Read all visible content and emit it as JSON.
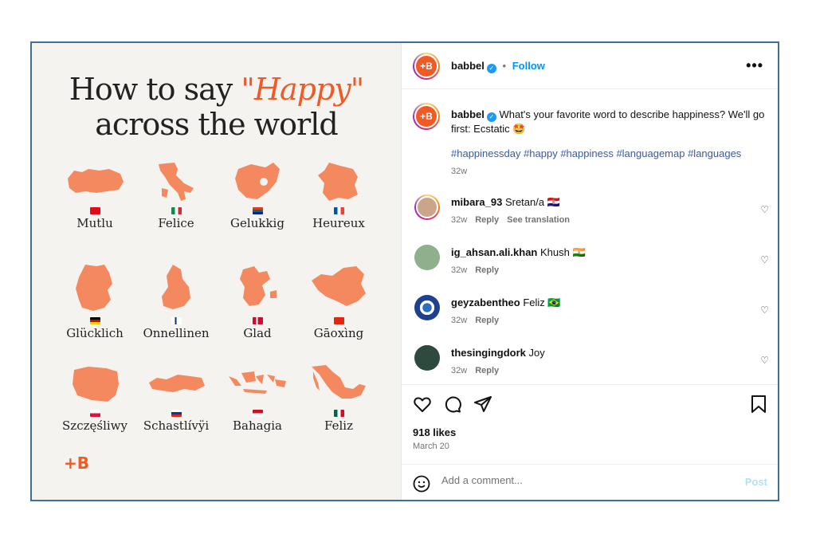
{
  "post_image": {
    "title_line1_prefix": "How to say ",
    "title_accent": "\"Happy\"",
    "title_line2": "across the world",
    "logo": "+B",
    "accent_color": "#f15a24",
    "items": [
      {
        "word": "Mutlu",
        "country": "Turkey"
      },
      {
        "word": "Felice",
        "country": "Italy"
      },
      {
        "word": "Gelukkig",
        "country": "South Africa"
      },
      {
        "word": "Heureux",
        "country": "France"
      },
      {
        "word": "Glücklich",
        "country": "Germany"
      },
      {
        "word": "Onnellinen",
        "country": "Finland"
      },
      {
        "word": "Glad",
        "country": "Denmark"
      },
      {
        "word": "Gāoxìng",
        "country": "China"
      },
      {
        "word": "Szczęśliwy",
        "country": "Poland"
      },
      {
        "word": "Schastlívÿi",
        "country": "Russia"
      },
      {
        "word": "Bahagia",
        "country": "Indonesia"
      },
      {
        "word": "Feliz",
        "country": "Mexico"
      }
    ]
  },
  "header": {
    "avatar_text": "+B",
    "username": "babbel",
    "separator": "•",
    "follow_label": "Follow",
    "more_icon": "more-horizontal-icon"
  },
  "caption": {
    "username": "babbel",
    "text": "What's your favorite word to describe happiness? We'll go first: Ecstatic 🤩",
    "hashtags": "#happinessday #happy #happiness #languagemap #languages",
    "time": "32w"
  },
  "comments": [
    {
      "username": "mibara_93",
      "text": "Sretan/a 🇭🇷",
      "time": "32w",
      "reply": "Reply",
      "translate": "See translation"
    },
    {
      "username": "ig_ahsan.ali.khan",
      "text": "Khush 🇮🇳",
      "time": "32w",
      "reply": "Reply"
    },
    {
      "username": "geyzabentheo",
      "text": "Feliz 🇧🇷",
      "time": "32w",
      "reply": "Reply"
    },
    {
      "username": "thesingingdork",
      "text": "Joy",
      "time": "32w",
      "reply": "Reply"
    }
  ],
  "actions": {
    "likes": "918 likes",
    "date": "March 20"
  },
  "comment_bar": {
    "placeholder": "Add a comment...",
    "post_label": "Post"
  }
}
